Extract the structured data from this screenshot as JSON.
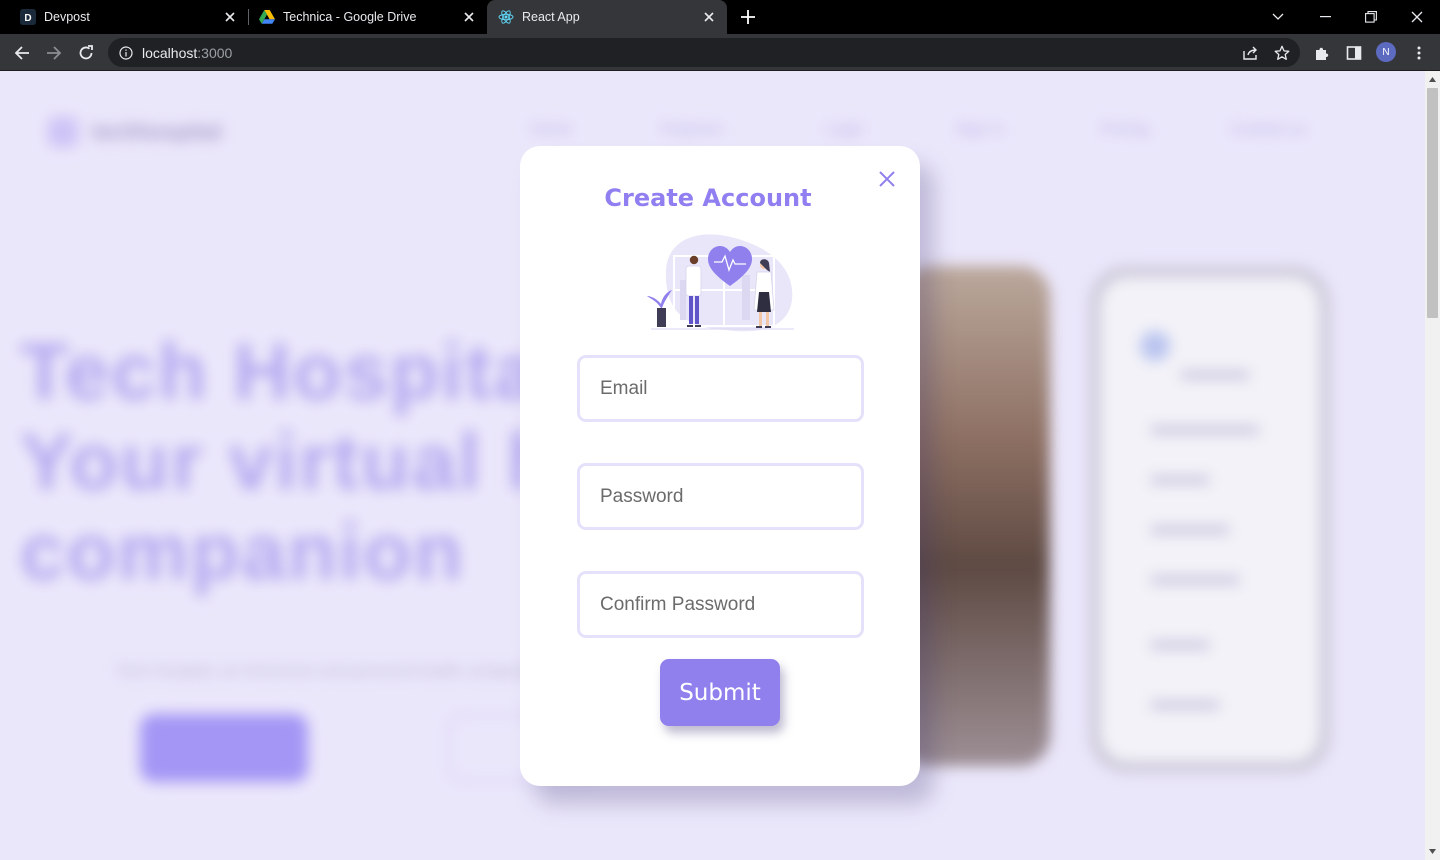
{
  "browser": {
    "tabs": [
      {
        "title": "Devpost",
        "favicon": "devpost-icon",
        "active": false
      },
      {
        "title": "Technica - Google Drive",
        "favicon": "google-drive-icon",
        "active": false
      },
      {
        "title": "React App",
        "favicon": "react-icon",
        "active": true
      }
    ],
    "url_host": "localhost",
    "url_port": ":3000",
    "profile_initial": "N"
  },
  "background_page": {
    "logo_text": "techhospital",
    "nav": [
      "Home",
      "Features",
      "Login",
      "Sign in",
      "Pricing",
      "Contact us"
    ],
    "hero_lines": [
      "Tech Hospital",
      "Your virtual he",
      "companion"
    ],
    "hero_subtitle": "Tech Hospital, an immersive and personal health companion"
  },
  "modal": {
    "title": "Create Account",
    "illustration": "doctors-heart-illustration",
    "fields": {
      "email_placeholder": "Email",
      "password_placeholder": "Password",
      "confirm_placeholder": "Confirm Password"
    },
    "submit_label": "Submit"
  },
  "colors": {
    "accent": "#8f80ee",
    "page_bg": "#ebe7fb",
    "field_border": "#e6e1fb",
    "chrome_bg": "#35363a"
  }
}
